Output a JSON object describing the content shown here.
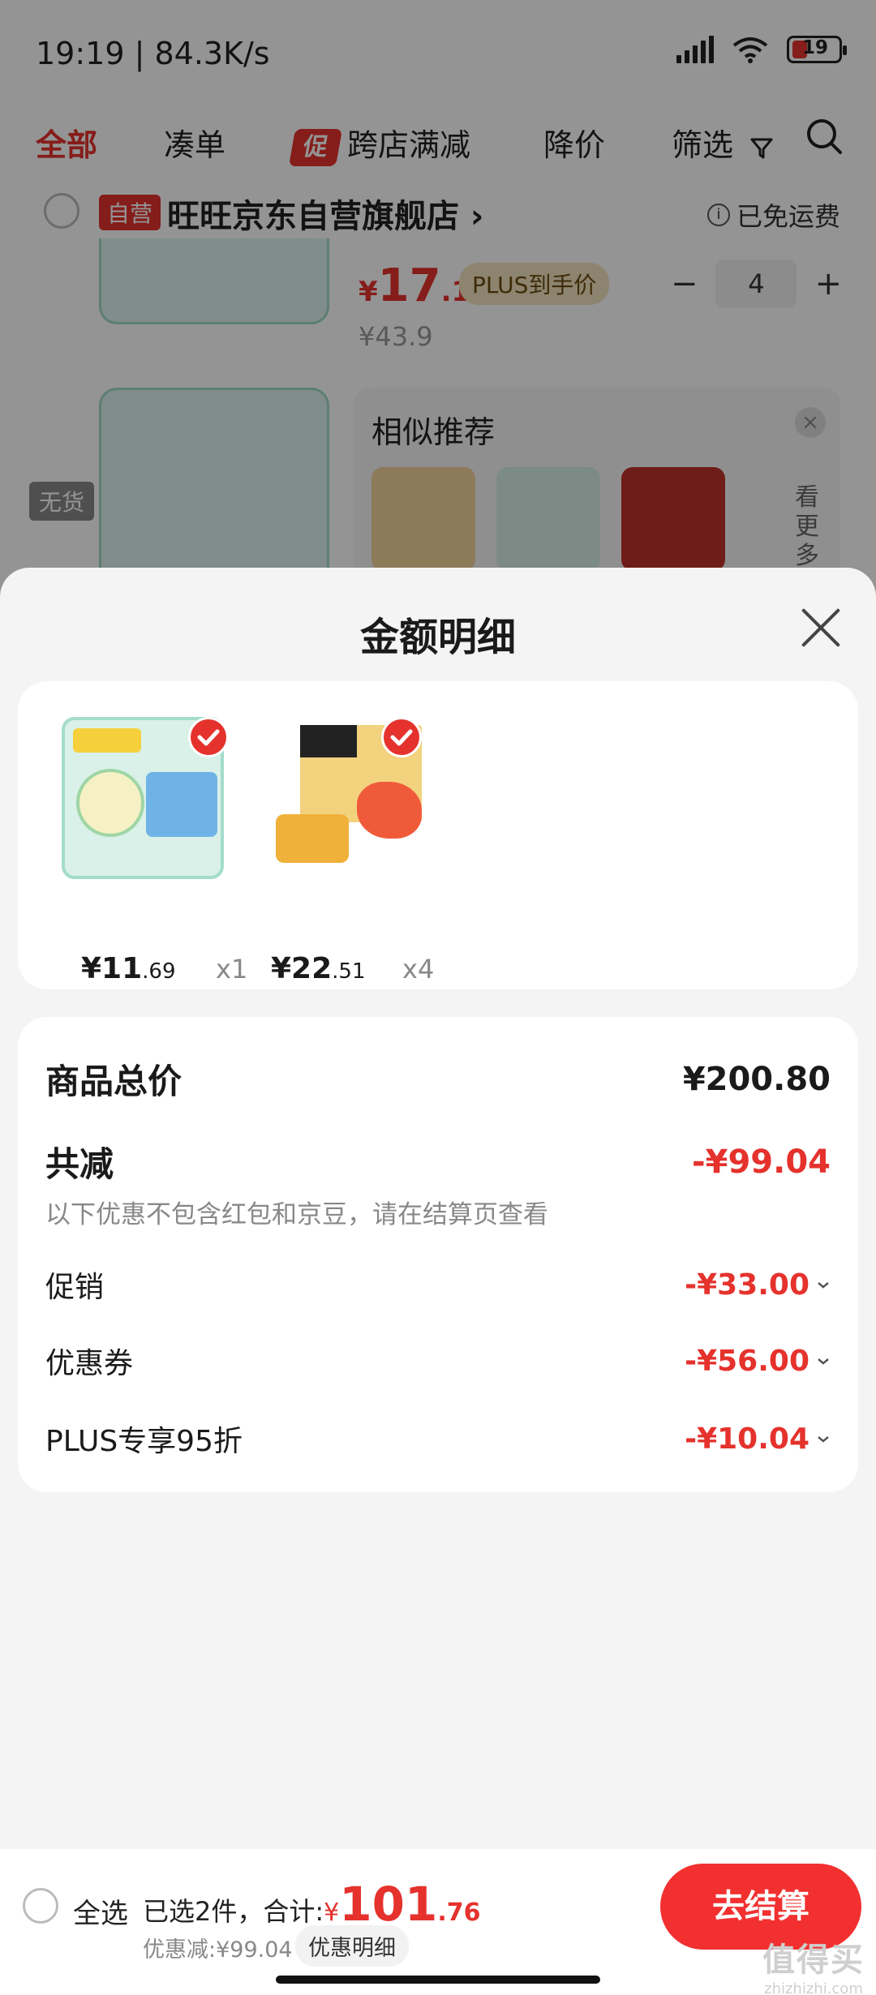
{
  "status_bar": {
    "time": "19:19 | 84.3K/s",
    "battery": "19"
  },
  "filter_bar": {
    "tabs": [
      "全部",
      "凑单",
      "跨店满减",
      "降价",
      "筛选"
    ],
    "promo_badge": "促"
  },
  "shop": {
    "tag": "自营",
    "name": "旺旺京东自营旗舰店 ›",
    "free_shipping": "已免运费",
    "info_icon": "i"
  },
  "product1": {
    "currency": "¥",
    "price_int": "17",
    "price_dec": ".12",
    "plus_tag": "PLUS到手价",
    "original_price": "¥43.9",
    "quantity": "4",
    "minus": "−",
    "plus": "+"
  },
  "product2": {
    "soldout": "无货"
  },
  "similar": {
    "title": "相似推荐",
    "close": "×",
    "more": "看更多"
  },
  "sheet": {
    "title": "金额明细",
    "items": [
      {
        "price_int": "¥11",
        "price_dec": ".69",
        "qty": "x1"
      },
      {
        "price_int": "¥22",
        "price_dec": ".51",
        "qty": "x4"
      }
    ],
    "summary": {
      "total_label": "商品总价",
      "total_value": "¥200.80",
      "reduce_label": "共减",
      "reduce_value": "-¥99.04",
      "note": "以下优惠不包含红包和京豆，请在结算页查看",
      "rows": [
        {
          "label": "促销",
          "value": "-¥33.00"
        },
        {
          "label": "优惠券",
          "value": "-¥56.00"
        },
        {
          "label": "PLUS专享95折",
          "value": "-¥10.04"
        }
      ]
    }
  },
  "bottom_bar": {
    "select_all": "全选",
    "selected_text": "已选2件，合计:",
    "currency": "¥",
    "total_int": "101",
    "total_dec": ".76",
    "discount_text": "优惠减:¥99.04",
    "discount_detail_btn": "优惠明细",
    "checkout": "去结算",
    "watermark": "值得买",
    "watermark_sub": "zhizhizhi.com"
  },
  "colors": {
    "accent": "#e5322d",
    "checkout": "#f23030",
    "background": "#f4f4f4"
  },
  "icons": [
    "signal-icon",
    "wifi-icon",
    "battery-icon",
    "filter-icon",
    "search-icon",
    "info-icon",
    "close-icon",
    "check-icon",
    "chevron-down-icon"
  ]
}
